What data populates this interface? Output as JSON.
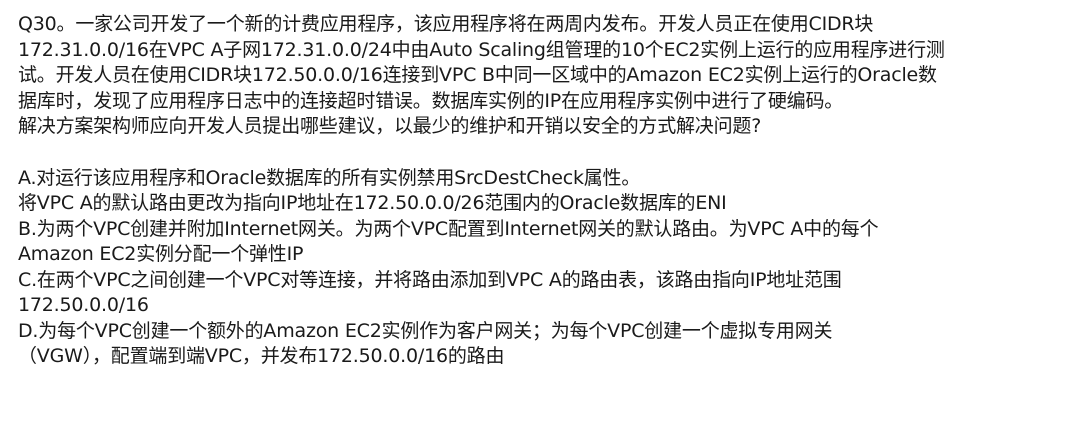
{
  "question": {
    "lines": [
      "Q30。一家公司开发了一个新的计费应用程序，该应用程序将在两周内发布。开发人员正在使用CIDR块",
      "172.31.0.0/16在VPC A子网172.31.0.0/24中由Auto Scaling组管理的10个EC2实例上运行的应用程序进行测",
      "试。开发人员在使用CIDR块172.50.0.0/16连接到VPC B中同一区域中的Amazon EC2实例上运行的Oracle数",
      "据库时，发现了应用程序日志中的连接超时错误。数据库实例的IP在应用程序实例中进行了硬编码。",
      "解决方案架构师应向开发人员提出哪些建议，以最少的维护和开销以安全的方式解决问题?"
    ]
  },
  "options": {
    "lines": [
      "A.对运行该应用程序和Oracle数据库的所有实例禁用SrcDestCheck属性。",
      "将VPC A的默认路由更改为指向IP地址在172.50.0.0/26范围内的Oracle数据库的ENI",
      "B.为两个VPC创建并附加Internet网关。为两个VPC配置到Internet网关的默认路由。为VPC A中的每个",
      "Amazon EC2实例分配一个弹性IP",
      "C.在两个VPC之间创建一个VPC对等连接，并将路由添加到VPC A的路由表，该路由指向IP地址范围",
      "172.50.0.0/16",
      "D.为每个VPC创建一个额外的Amazon EC2实例作为客户网关；为每个VPC创建一个虚拟专用网关",
      "（VGW），配置端到端VPC，并发布172.50.0.0/16的路由"
    ]
  }
}
